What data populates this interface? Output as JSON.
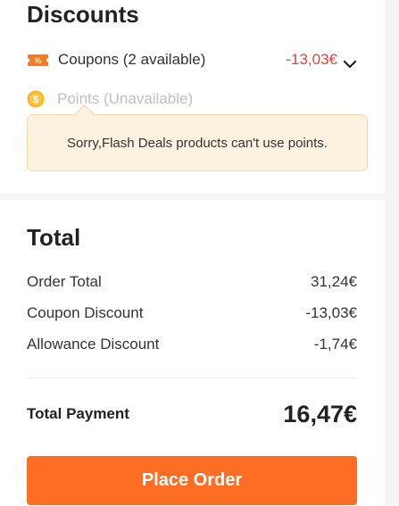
{
  "discounts": {
    "title": "Discounts",
    "coupons": {
      "label": "Coupons (2 available)",
      "amount": "-13,03€",
      "icon": "coupon-icon"
    },
    "points": {
      "label": "Points (Unavailable)",
      "icon": "coin-icon",
      "tooltip": "Sorry,Flash Deals products can't use points."
    }
  },
  "total": {
    "title": "Total",
    "rows": [
      {
        "label": "Order Total",
        "value": "31,24€"
      },
      {
        "label": "Coupon Discount",
        "value": "-13,03€"
      },
      {
        "label": "Allowance Discount",
        "value": "-1,74€"
      }
    ],
    "payment_label": "Total Payment",
    "payment_value": "16,47€"
  },
  "actions": {
    "place_order_label": "Place Order"
  },
  "colors": {
    "accent": "#fd6d23",
    "discount_red": "#e5413a",
    "tooltip_bg": "#fdf1df",
    "tooltip_border": "#f6d8a8",
    "coin": "#f7b529"
  }
}
